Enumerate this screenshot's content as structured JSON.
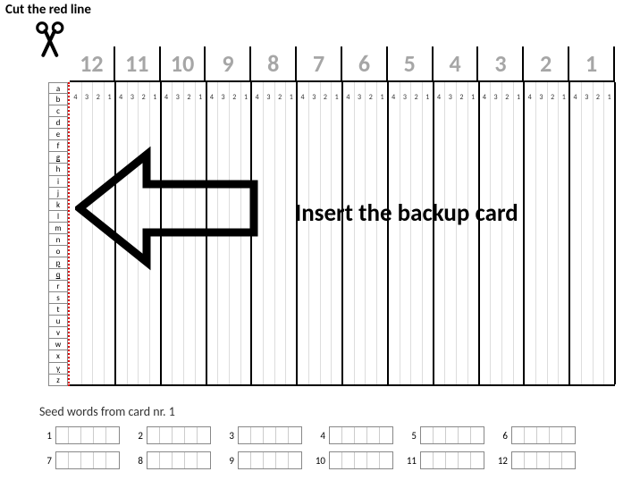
{
  "labels": {
    "cut": "Cut the red line",
    "insert": "Insert the backup card",
    "seed_title": "Seed words from card nr. 1"
  },
  "icons": {
    "scissors": "scissors-icon",
    "arrow": "arrow-left-icon"
  },
  "columns": [
    "12",
    "11",
    "10",
    "9",
    "8",
    "7",
    "6",
    "5",
    "4",
    "3",
    "2",
    "1"
  ],
  "sub_columns": [
    "4",
    "3",
    "2",
    "1"
  ],
  "rows": [
    "a",
    "b",
    "c",
    "d",
    "e",
    "f",
    "g",
    "h",
    "i",
    "j",
    "k",
    "l",
    "m",
    "n",
    "o",
    "p",
    "q",
    "r",
    "s",
    "t",
    "u",
    "v",
    "w",
    "x",
    "y",
    "z"
  ],
  "underlined_rows": [
    "g",
    "j",
    "p",
    "q",
    "y"
  ],
  "seed_slots": [
    1,
    2,
    3,
    4,
    5,
    6,
    7,
    8,
    9,
    10,
    11,
    12
  ],
  "seed_cells_per_slot": 5,
  "chart_data": {
    "type": "table",
    "title": "Backup card insertion template",
    "columns_major": [
      12,
      11,
      10,
      9,
      8,
      7,
      6,
      5,
      4,
      3,
      2,
      1
    ],
    "columns_minor": [
      4,
      3,
      2,
      1
    ],
    "rows": [
      "a",
      "b",
      "c",
      "d",
      "e",
      "f",
      "g",
      "h",
      "i",
      "j",
      "k",
      "l",
      "m",
      "n",
      "o",
      "p",
      "q",
      "r",
      "s",
      "t",
      "u",
      "v",
      "w",
      "x",
      "y",
      "z"
    ],
    "annotations": [
      "Cut the red line",
      "Insert the backup card"
    ],
    "seed_word_slots": 12
  }
}
